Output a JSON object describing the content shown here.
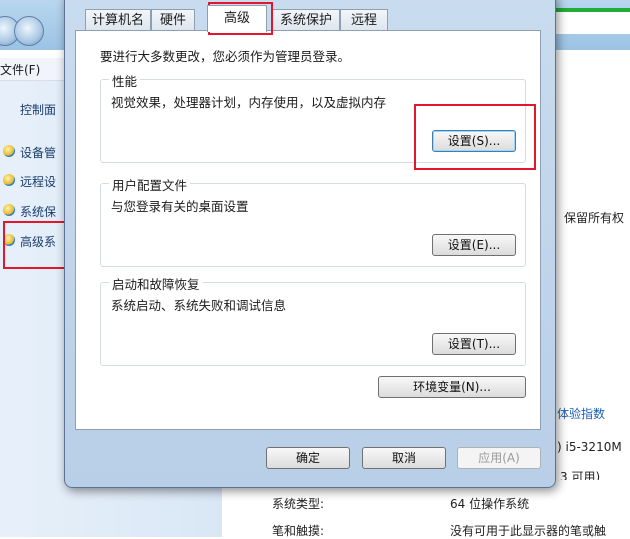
{
  "background": {
    "menu_file": "文件(F)",
    "control_panel_home": "控制面",
    "sidebar_items": [
      "设备管",
      "远程设",
      "系统保",
      "高级系"
    ],
    "right_texts": {
      "rights": "保留所有权",
      "experience_index": "体验指数",
      "cpu": ") i5-3210M",
      "memory": "3 可用)",
      "system_type_label": "系统类型:",
      "system_type_value": "64 位操作系统",
      "pen_touch_label": "笔和触摸:",
      "pen_touch_value": "没有可用于此显示器的笔或触"
    },
    "colors": {
      "annotation_red": "#e3162b",
      "accent_green": "#1fae3a"
    }
  },
  "dialog": {
    "tabs": [
      "计算机名",
      "硬件",
      "高级",
      "系统保护",
      "远程"
    ],
    "active_tab": "高级",
    "admin_notice": "要进行大多数更改，您必须作为管理员登录。",
    "groups": {
      "performance": {
        "title": "性能",
        "desc": "视觉效果，处理器计划，内存使用，以及虚拟内存",
        "button": "设置(S)..."
      },
      "user_profiles": {
        "title": "用户配置文件",
        "desc": "与您登录有关的桌面设置",
        "button": "设置(E)..."
      },
      "startup_recovery": {
        "title": "启动和故障恢复",
        "desc": "系统启动、系统失败和调试信息",
        "button": "设置(T)..."
      }
    },
    "env_vars_button": "环境变量(N)...",
    "footer": {
      "ok": "确定",
      "cancel": "取消",
      "apply": "应用(A)"
    }
  }
}
